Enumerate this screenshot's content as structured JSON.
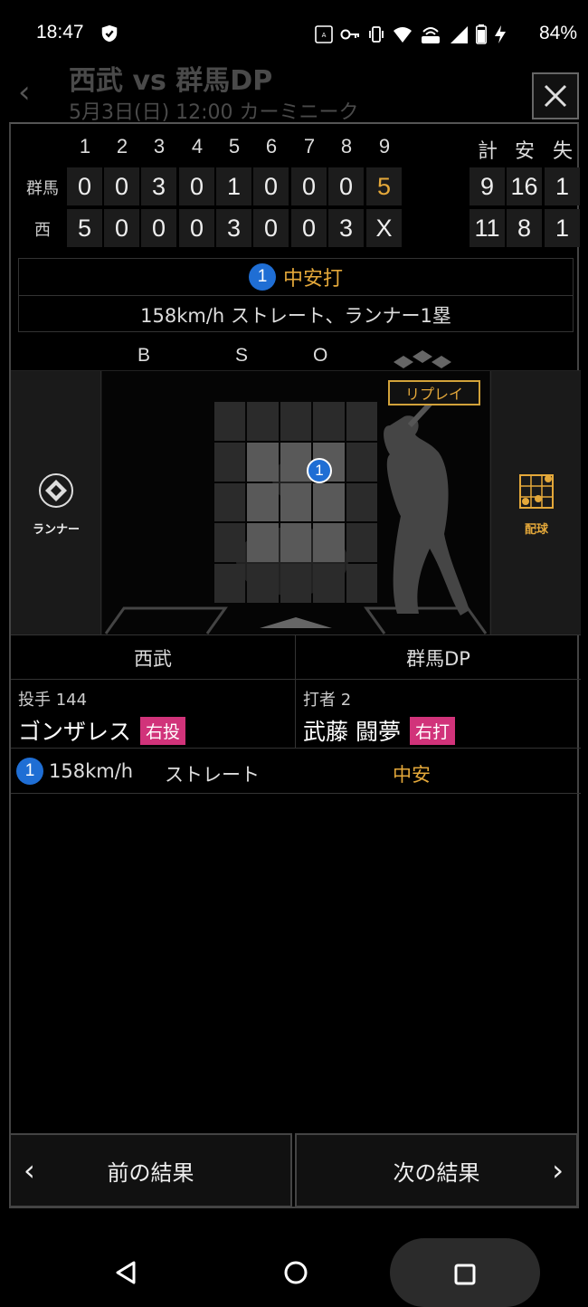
{
  "status_bar": {
    "time": "18:47",
    "battery": "84%"
  },
  "background": {
    "title": "西武 vs 群馬DP",
    "subtitle": "5月3日(日) 12:00 カーミニーク"
  },
  "scoreboard": {
    "innings": [
      "1",
      "2",
      "3",
      "4",
      "5",
      "6",
      "7",
      "8",
      "9"
    ],
    "totals_headers": [
      "計",
      "安",
      "失"
    ],
    "rows": [
      {
        "team": "群馬",
        "scores": [
          "0",
          "0",
          "3",
          "0",
          "1",
          "0",
          "0",
          "0",
          "5"
        ],
        "totals": [
          "9",
          "16",
          "1"
        ]
      },
      {
        "team": "西",
        "scores": [
          "5",
          "0",
          "0",
          "0",
          "3",
          "0",
          "0",
          "3",
          "X"
        ],
        "totals": [
          "11",
          "8",
          "1"
        ]
      }
    ]
  },
  "play": {
    "number": "1",
    "result": "中安打",
    "description": "158km/h ストレート、ランナー1塁"
  },
  "count": {
    "b": "B",
    "s": "S",
    "o": "O"
  },
  "field": {
    "runner_label": "ランナー",
    "pitch_label": "配球",
    "replay": "リプレイ",
    "pitch_marker": "1"
  },
  "teams": {
    "left": "西武",
    "right": "群馬DP"
  },
  "pitcher": {
    "role": "投手",
    "number": "144",
    "name": "ゴンザレス",
    "hand": "右投"
  },
  "batter": {
    "role": "打者",
    "number": "2",
    "name": "武藤 闘夢",
    "hand": "右打"
  },
  "pitch_row": {
    "number": "1",
    "speed": "158km/h",
    "type": "ストレート",
    "result": "中安"
  },
  "nav": {
    "prev": "前の結果",
    "next": "次の結果"
  },
  "colors": {
    "accent": "#e4a83a",
    "badge_blue": "#1f6ed4",
    "hand_badge": "#d1337a"
  }
}
